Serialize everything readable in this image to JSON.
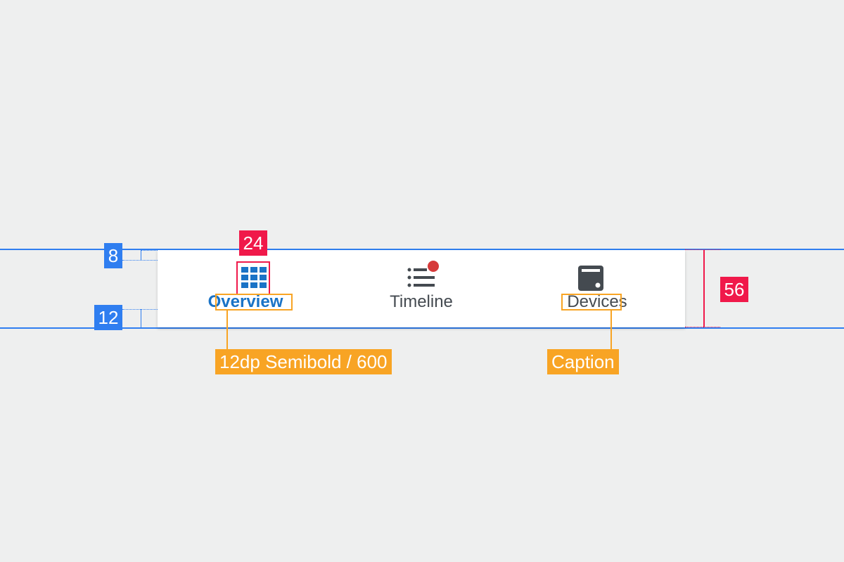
{
  "nav": {
    "items": [
      {
        "label": "Overview",
        "icon": "grid-icon",
        "active": true
      },
      {
        "label": "Timeline",
        "icon": "list-icon",
        "active": false,
        "badge_dot": true
      },
      {
        "label": "Devices",
        "icon": "device-icon",
        "active": false
      }
    ]
  },
  "annotations": {
    "top_padding": "8",
    "bottom_padding": "12",
    "icon_size": "24",
    "bar_height": "56",
    "label_font": "12dp Semibold / 600",
    "caption": "Caption"
  },
  "colors": {
    "background": "#eeefef",
    "guide_blue": "#2f7ef0",
    "guide_red": "#f0194a",
    "annotation_orange": "#f8a424",
    "active": "#1a73c6",
    "inactive": "#444a50",
    "notification_dot": "#d63a3a"
  }
}
